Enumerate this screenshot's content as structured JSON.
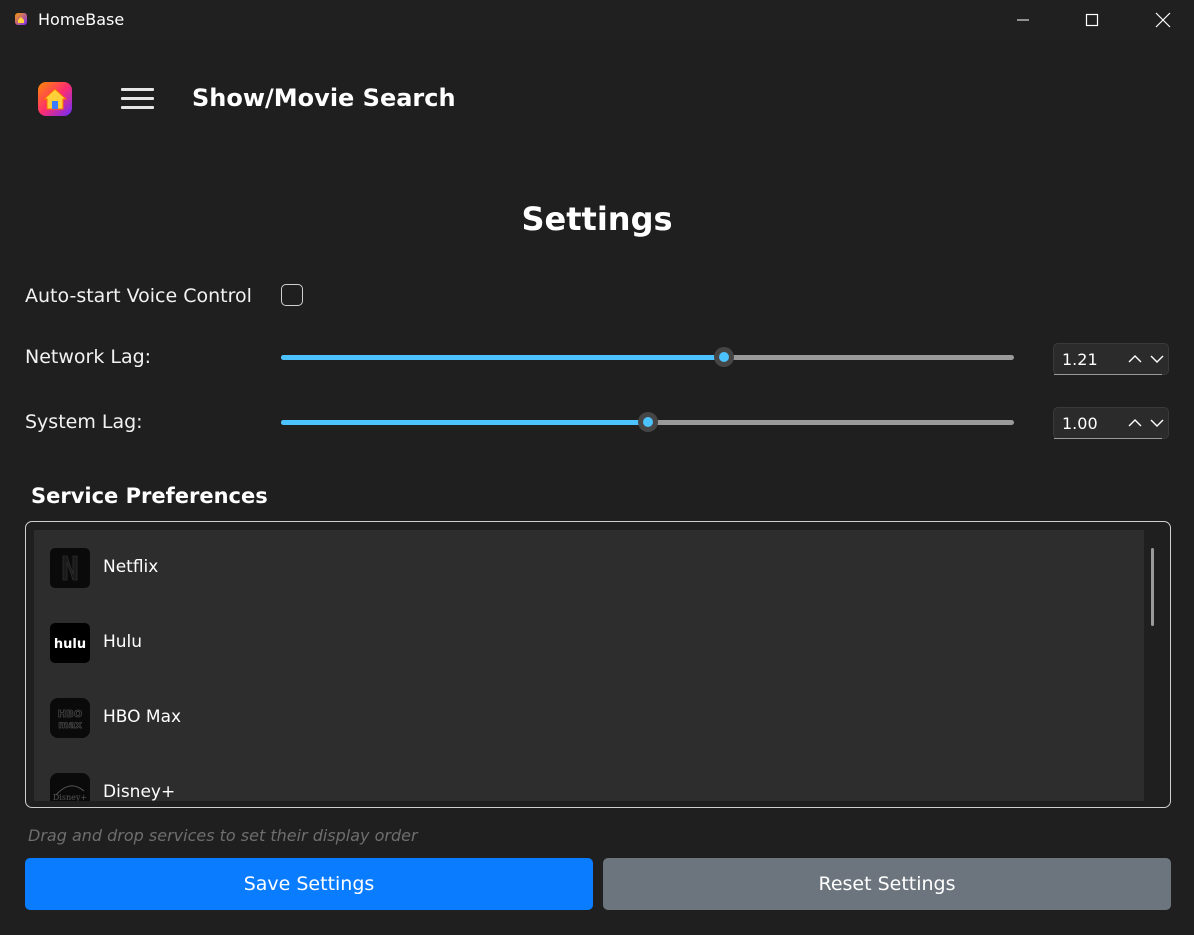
{
  "window": {
    "title": "HomeBase"
  },
  "header": {
    "page_title": "Show/Movie Search"
  },
  "settings": {
    "heading": "Settings",
    "auto_start_label": "Auto-start Voice Control",
    "auto_start_checked": false,
    "network_lag": {
      "label": "Network Lag:",
      "value": "1.21",
      "slider_fraction": 0.605
    },
    "system_lag": {
      "label": "System Lag:",
      "value": "1.00",
      "slider_fraction": 0.5
    }
  },
  "services": {
    "title": "Service Preferences",
    "items": [
      {
        "name": "Netflix",
        "icon": "netflix-icon"
      },
      {
        "name": "Hulu",
        "icon": "hulu-icon"
      },
      {
        "name": "HBO Max",
        "icon": "hbo-max-icon"
      },
      {
        "name": "Disney+",
        "icon": "disney-plus-icon"
      }
    ],
    "hint": "Drag and drop services to set their display order"
  },
  "buttons": {
    "save_label": "Save Settings",
    "reset_label": "Reset Settings"
  },
  "colors": {
    "accent": "#4cc2ff",
    "save_button": "#0a7cff",
    "reset_button": "#6c757d",
    "background": "#1f1f1f"
  }
}
